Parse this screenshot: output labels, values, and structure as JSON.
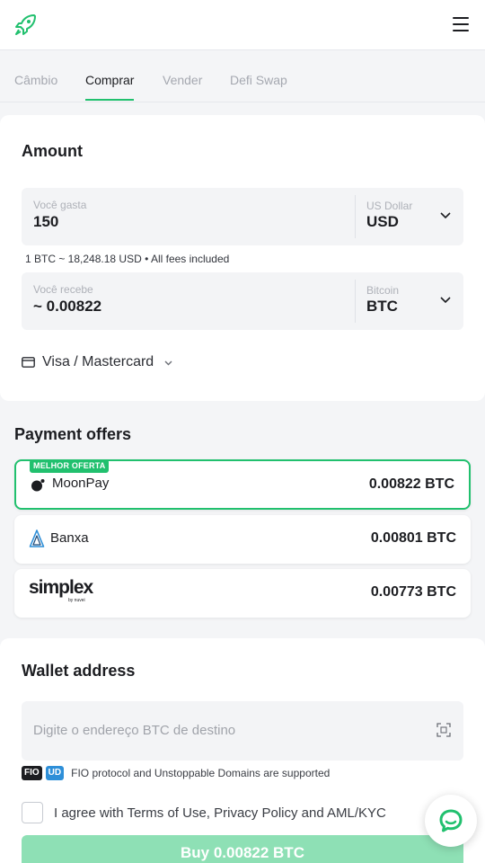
{
  "tabs": [
    {
      "label": "Câmbio"
    },
    {
      "label": "Comprar",
      "active": true
    },
    {
      "label": "Vender"
    },
    {
      "label": "Defi Swap"
    }
  ],
  "amount": {
    "title": "Amount",
    "spend": {
      "label": "Você gasta",
      "value": "150",
      "currency_label": "US Dollar",
      "currency": "USD"
    },
    "rate_text": "1 BTC ~ 18,248.18 USD • All fees included",
    "receive": {
      "label": "Você recebe",
      "value": "~ 0.00822",
      "currency_label": "Bitcoin",
      "currency": "BTC"
    },
    "payment_method": "Visa / Mastercard"
  },
  "offers": {
    "title": "Payment offers",
    "best_label": "MELHOR OFERTA",
    "items": [
      {
        "name": "MoonPay",
        "amount": "0.00822 BTC"
      },
      {
        "name": "Banxa",
        "amount": "0.00801 BTC"
      },
      {
        "name": "simplex",
        "sub": "by nuvei",
        "amount": "0.00773 BTC"
      }
    ]
  },
  "wallet": {
    "title": "Wallet address",
    "placeholder": "Digite o endereço BTC de destino",
    "tag_fio": "FIO",
    "tag_ud": "UD",
    "support_text": "FIO protocol and Unstoppable Domains are supported",
    "agree_text": "I agree with Terms of Use, Privacy Policy  and AML/KYC",
    "buy_label": "Buy 0.00822 BTC"
  },
  "colors": {
    "accent": "#21c06e",
    "button_disabled": "#8ee0b5",
    "fio_tag": "#1c1d21",
    "ud_tag": "#2e8fd8"
  },
  "icons": {
    "logo": "rocket-logo-icon",
    "menu": "hamburger-menu-icon",
    "card": "credit-card-icon",
    "scan": "qr-scan-icon",
    "chat": "chat-bubble-icon"
  }
}
